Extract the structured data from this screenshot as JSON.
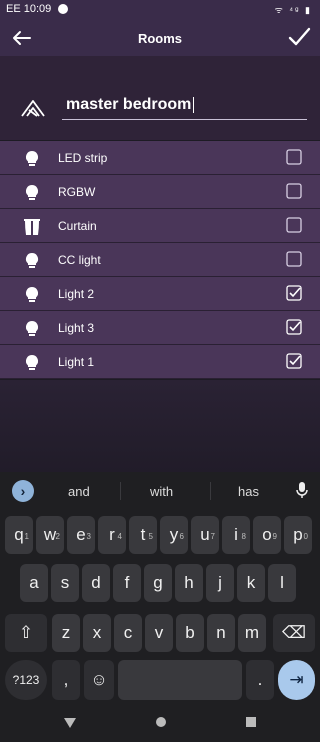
{
  "status_bar": {
    "time": "EE 10:09",
    "right_icons": "ᯤ ⁴ᵍ ▮"
  },
  "app_bar": {
    "title": "Rooms"
  },
  "room": {
    "name": "master bedroom"
  },
  "devices": [
    {
      "label": "LED strip",
      "icon": "bulb-icon",
      "checked": false
    },
    {
      "label": "RGBW",
      "icon": "bulb-icon",
      "checked": false
    },
    {
      "label": "Curtain",
      "icon": "curtain-icon",
      "checked": false
    },
    {
      "label": "CC light",
      "icon": "bulb-icon",
      "checked": false
    },
    {
      "label": "Light 2",
      "icon": "bulb-icon",
      "checked": true
    },
    {
      "label": "Light 3",
      "icon": "bulb-icon",
      "checked": true
    },
    {
      "label": "Light 1",
      "icon": "bulb-icon",
      "checked": true
    }
  ],
  "keyboard": {
    "suggestions": [
      "and",
      "with",
      "has"
    ],
    "row1": [
      {
        "c": "q",
        "h": "1"
      },
      {
        "c": "w",
        "h": "2"
      },
      {
        "c": "e",
        "h": "3"
      },
      {
        "c": "r",
        "h": "4"
      },
      {
        "c": "t",
        "h": "5"
      },
      {
        "c": "y",
        "h": "6"
      },
      {
        "c": "u",
        "h": "7"
      },
      {
        "c": "i",
        "h": "8"
      },
      {
        "c": "o",
        "h": "9"
      },
      {
        "c": "p",
        "h": "0"
      }
    ],
    "row2": [
      "a",
      "s",
      "d",
      "f",
      "g",
      "h",
      "j",
      "k",
      "l"
    ],
    "row3": [
      "z",
      "x",
      "c",
      "v",
      "b",
      "n",
      "m"
    ],
    "symbols_label": "?123",
    "comma": ",",
    "period": ".",
    "emoji": "☺",
    "enter": "⇥",
    "shift": "⇧",
    "backspace": "⌫"
  },
  "colors": {
    "accent": "#4a3659",
    "checkbox": "#d8cfe3"
  }
}
